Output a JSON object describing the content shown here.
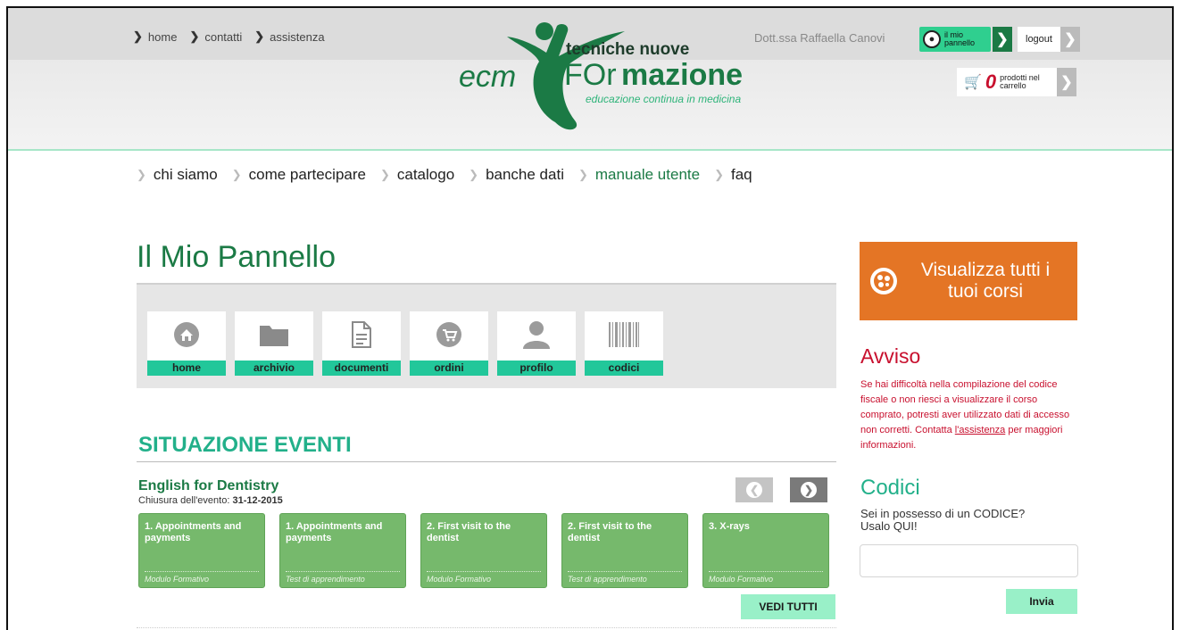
{
  "topnav": [
    "home",
    "contatti",
    "assistenza"
  ],
  "logo": {
    "brand_top": "tecniche nuove",
    "ecm": "ecm",
    "formazione_a": "FOr",
    "formazione_b": "mazione",
    "tagline": "educazione continua in medicina"
  },
  "user": {
    "name": "Dott.ssa Raffaella Canovi",
    "panel_label_1": "il mio",
    "panel_label_2": "pannello",
    "logout_label": "logout"
  },
  "cart": {
    "count": "0",
    "label_1": "prodotti nel",
    "label_2": "carrello"
  },
  "mainnav": [
    {
      "label": "chi siamo",
      "active": false
    },
    {
      "label": "come partecipare",
      "active": false
    },
    {
      "label": "catalogo",
      "active": false
    },
    {
      "label": "banche dati",
      "active": false
    },
    {
      "label": "manuale utente",
      "active": true
    },
    {
      "label": "faq",
      "active": false
    }
  ],
  "page_title": "Il Mio Pannello",
  "tiles": [
    {
      "label": "home",
      "icon": "home-icon"
    },
    {
      "label": "archivio",
      "icon": "folder-icon"
    },
    {
      "label": "documenti",
      "icon": "document-icon"
    },
    {
      "label": "ordini",
      "icon": "cart-icon"
    },
    {
      "label": "profilo",
      "icon": "user-icon"
    },
    {
      "label": "codici",
      "icon": "barcode-icon"
    }
  ],
  "events": {
    "section_title": "SITUAZIONE EVENTI",
    "title": "English for Dentistry",
    "close_label": "Chiusura dell'evento:",
    "close_date": "31-12-2015",
    "cards": [
      {
        "title": "1. Appointments and payments",
        "sub": "Modulo Formativo"
      },
      {
        "title": "1. Appointments and payments",
        "sub": "Test di apprendimento"
      },
      {
        "title": "2. First visit to the dentist",
        "sub": "Modulo Formativo"
      },
      {
        "title": "2. First visit to the dentist",
        "sub": "Test di apprendimento"
      },
      {
        "title": "3. X-rays",
        "sub": "Modulo Formativo"
      }
    ],
    "vedi_tutti": "VEDI TUTTI"
  },
  "sidebar": {
    "courses_button": "Visualizza tutti i tuoi corsi",
    "avviso_title": "Avviso",
    "avviso_text_before": "Se hai difficoltà nella compilazione del codice fiscale o non riesci a visualizzare il corso comprato, potresti aver utilizzato dati di accesso non corretti. Contatta ",
    "avviso_link": "l'assistenza",
    "avviso_text_after": " per maggiori informazioni.",
    "codici_title": "Codici",
    "codici_text": "Sei in possesso di un CODICE? Usalo QUI!",
    "codici_placeholder": "",
    "invia_label": "Invia"
  },
  "colors": {
    "brand_green": "#1b7a45",
    "accent_teal": "#22c79a",
    "orange": "#e47525",
    "alert_red": "#c8102e",
    "card_green": "#76b96c"
  }
}
